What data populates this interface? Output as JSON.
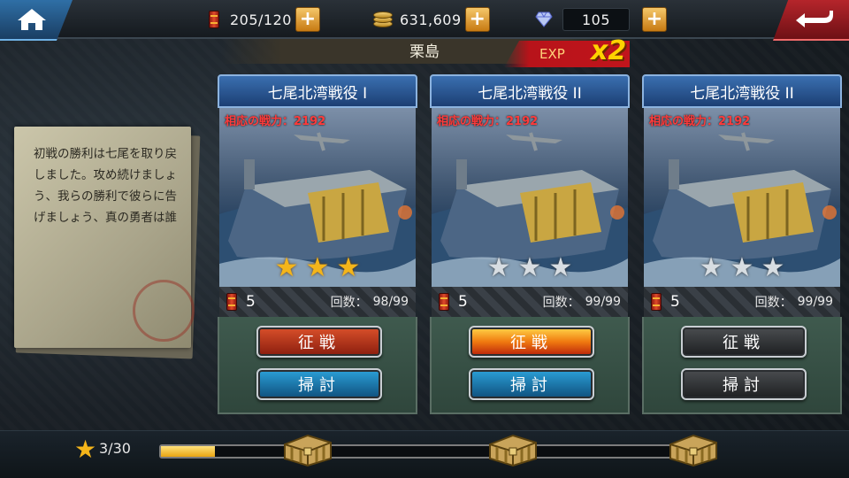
{
  "resources": {
    "fuel": "205/120",
    "coins": "631,609",
    "gems": "105"
  },
  "stage": {
    "name": "栗島",
    "exp_label": "EXP",
    "exp_multiplier": "x2"
  },
  "story": {
    "text": "初戦の勝利は七尾を取り戻しました。攻め続けましょう、我らの勝利で彼らに告げましょう、真の勇者は誰"
  },
  "cards": [
    {
      "title": "七尾北湾戦役 I",
      "power_label": "相応の戦力：",
      "power": "2192",
      "stars_earned": 3,
      "stars_total": 3,
      "fuel_cost": "5",
      "count_label": "回数：",
      "count": "98/99",
      "attack_label": "征戦",
      "sweep_label": "掃討",
      "attack_style": "red",
      "sweep_style": "blue"
    },
    {
      "title": "七尾北湾戦役 II",
      "power_label": "相応の戦力：",
      "power": "2192",
      "stars_earned": 0,
      "stars_total": 3,
      "fuel_cost": "5",
      "count_label": "回数：",
      "count": "99/99",
      "attack_label": "征戦",
      "sweep_label": "掃討",
      "attack_style": "fire",
      "sweep_style": "blue"
    },
    {
      "title": "七尾北湾戦役 II",
      "power_label": "相応の戦力：",
      "power": "2192",
      "stars_earned": 0,
      "stars_total": 3,
      "fuel_cost": "5",
      "count_label": "回数：",
      "count": "99/99",
      "attack_label": "征戦",
      "sweep_label": "掃討",
      "attack_style": "dark",
      "sweep_style": "dark"
    }
  ],
  "progress": {
    "text": "3/30",
    "stars": 3,
    "max": 30
  },
  "icons": {
    "home": "home-icon",
    "back": "back-arrow-icon",
    "fuel": "fuel-barrel-icon",
    "coins": "coin-stack-icon",
    "gems": "diamond-icon",
    "star": "star-icon",
    "chest": "treasure-chest-icon"
  },
  "colors": {
    "power_text": "#ff3b3b",
    "star_gold": "#f4b51a",
    "star_silver": "#d7dde2",
    "exp_badge": "#c0151c",
    "x2": "#ffd200",
    "card_header": "#1c3f74"
  }
}
